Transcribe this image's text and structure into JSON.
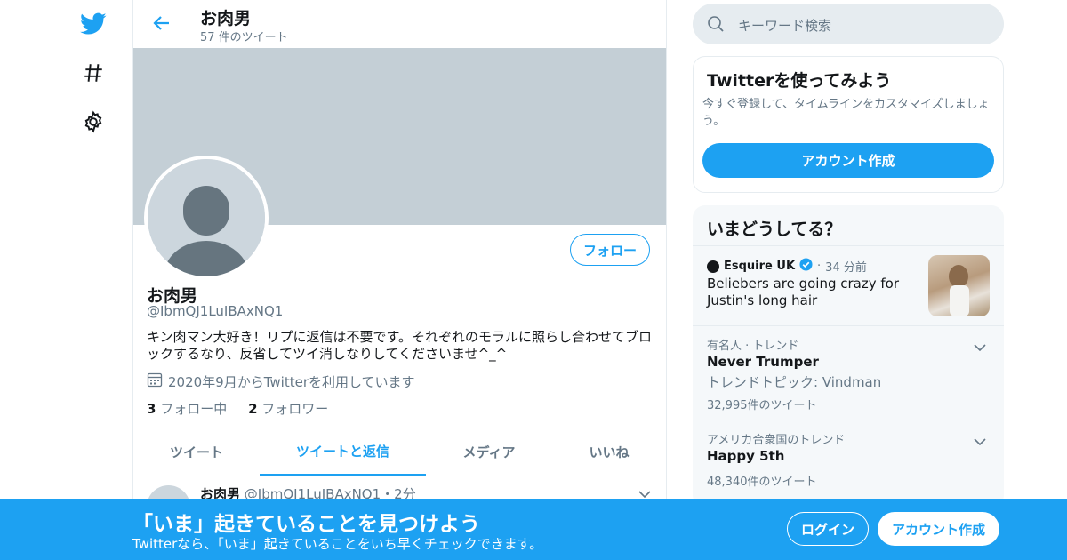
{
  "colors": {
    "accent": "#1da1f2",
    "banner": "#c4cfd6",
    "muted": "#657786"
  },
  "nav": {
    "items": [
      {
        "icon": "twitter-bird-icon"
      },
      {
        "icon": "hashtag-icon"
      },
      {
        "icon": "gear-icon"
      }
    ]
  },
  "header": {
    "title": "お肉男",
    "tweet_count": "57 件のツイート"
  },
  "profile": {
    "name": "お肉男",
    "handle": "@IbmQJ1LuIBAxNQ1",
    "follow_label": "フォロー",
    "bio": "キン肉マン大好き！リプに返信は不要です。それぞれのモラルに照らし合わせてブロックするなり、反省してツイ消しなりしてくださいませ^_^",
    "joined": "2020年9月からTwitterを利用しています",
    "following_count": "3",
    "following_label": "フォロー中",
    "followers_count": "2",
    "followers_label": "フォロワー"
  },
  "tabs": [
    {
      "label": "ツイート",
      "active": false
    },
    {
      "label": "ツイートと返信",
      "active": true
    },
    {
      "label": "メディア",
      "active": false
    },
    {
      "label": "いいね",
      "active": false
    }
  ],
  "tweet_peek": {
    "name": "お肉男",
    "handle": "@IbmQJ1LuIBAxNQ1",
    "time": "・2分"
  },
  "search": {
    "placeholder": "キーワード検索"
  },
  "promo_card": {
    "title": "Twitterを使ってみよう",
    "desc": "今すぐ登録して、タイムラインをカスタマイズしましょう。",
    "button": "アカウント作成"
  },
  "trends": {
    "title": "いまどうしてる？",
    "news": {
      "source": "Esquire UK",
      "time": "34 分前",
      "headline": "Beliebers are going crazy for Justin's long hair"
    },
    "items": [
      {
        "context": "有名人 · トレンド",
        "name": "Never Trumper",
        "topic": "トレンドトピック: Vindman",
        "count": "32,995件のツイート"
      },
      {
        "context": "アメリカ合衆国のトレンド",
        "name": "Happy 5th",
        "count": "48,340件のツイート"
      }
    ]
  },
  "bottom_bar": {
    "title": "「いま」起きていることを見つけよう",
    "subtitle": "Twitterなら、「いま」起きていることをいち早くチェックできます。",
    "login": "ログイン",
    "signup": "アカウント作成"
  }
}
